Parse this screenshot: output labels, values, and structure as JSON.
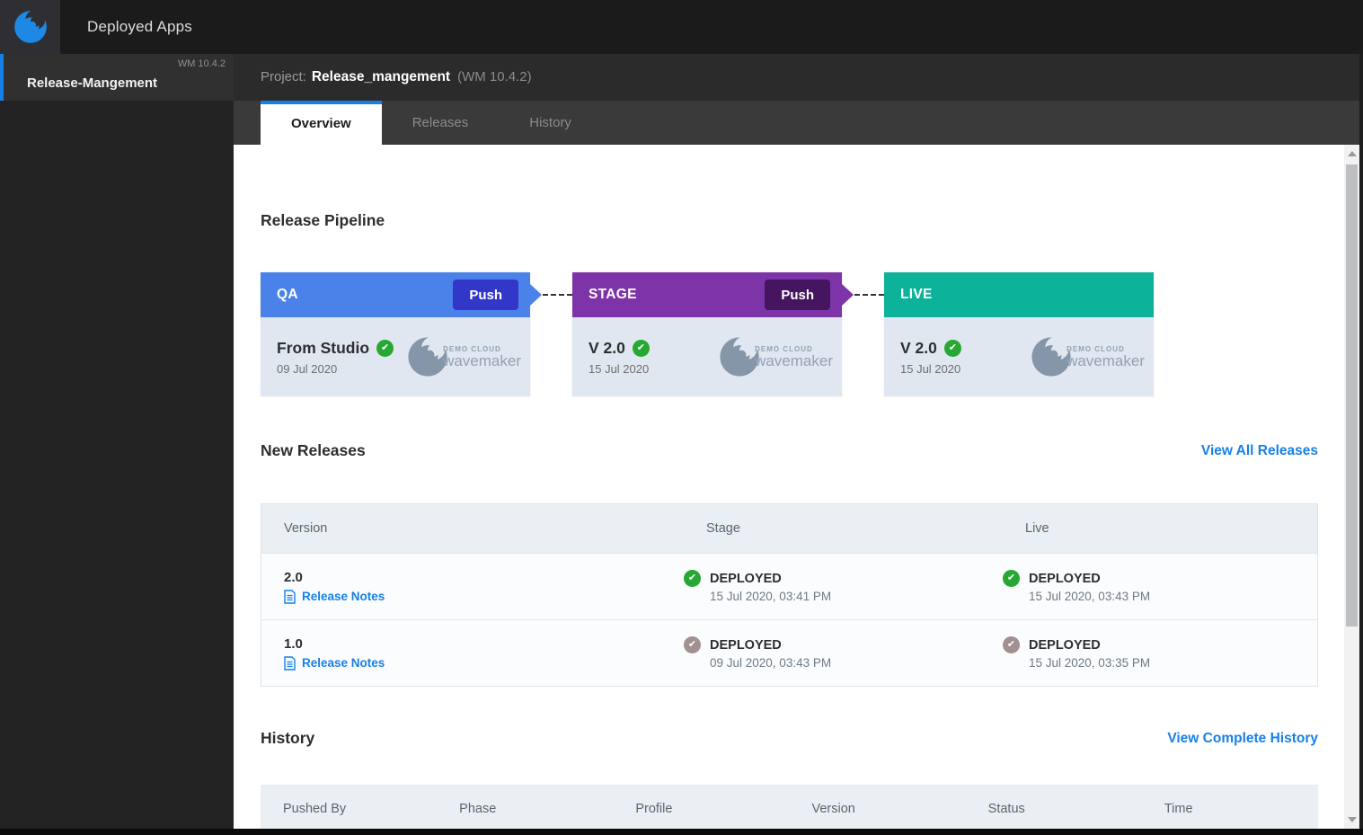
{
  "topbar": {
    "title": "Deployed Apps"
  },
  "sidebar": {
    "item": {
      "label": "Release-Mangement",
      "version": "WM 10.4.2"
    }
  },
  "project_header": {
    "prefix": "Project:",
    "name": "Release_mangement",
    "version": "(WM 10.4.2)"
  },
  "tabs": [
    {
      "label": "Overview",
      "active": true
    },
    {
      "label": "Releases",
      "active": false
    },
    {
      "label": "History",
      "active": false
    }
  ],
  "pipeline": {
    "heading": "Release Pipeline",
    "logo_text_top": "DEMO CLOUD",
    "logo_text_bottom": "wavemaker",
    "stages": [
      {
        "name": "QA",
        "push_label": "Push",
        "header_color": "#4a82ea",
        "push_color": "#3236c9",
        "version": "From Studio",
        "date": "09 Jul 2020",
        "check_color": "#26a832"
      },
      {
        "name": "STAGE",
        "push_label": "Push",
        "header_color": "#7d34a8",
        "push_color": "#45155f",
        "version": "V 2.0",
        "date": "15 Jul 2020",
        "check_color": "#26a832"
      },
      {
        "name": "LIVE",
        "header_color": "#0cb299",
        "version": "V 2.0",
        "date": "15 Jul 2020",
        "check_color": "#26a832"
      }
    ]
  },
  "new_releases": {
    "heading": "New Releases",
    "link": "View All Releases",
    "columns": [
      "Version",
      "Stage",
      "Live"
    ],
    "rows": [
      {
        "version": "2.0",
        "notes_label": "Release Notes",
        "stage": {
          "status": "DEPLOYED",
          "time": "15 Jul 2020, 03:41 PM",
          "check_color": "#26a832"
        },
        "live": {
          "status": "DEPLOYED",
          "time": "15 Jul 2020, 03:43 PM",
          "check_color": "#26a832"
        }
      },
      {
        "version": "1.0",
        "notes_label": "Release Notes",
        "stage": {
          "status": "DEPLOYED",
          "time": "09 Jul 2020, 03:43 PM",
          "check_color": "#a39090"
        },
        "live": {
          "status": "DEPLOYED",
          "time": "15 Jul 2020, 03:35 PM",
          "check_color": "#a39090"
        }
      }
    ]
  },
  "history": {
    "heading": "History",
    "link": "View Complete History",
    "columns": [
      "Pushed By",
      "Phase",
      "Profile",
      "Version",
      "Status",
      "Time"
    ]
  },
  "colors": {
    "accent_blue": "#1780e8",
    "qa_header": "#4a82ea",
    "qa_push": "#3236c9",
    "stage_header": "#7d34a8",
    "stage_push": "#45155f",
    "live_header": "#0cb299",
    "green_check": "#26a832",
    "muted_check": "#a39090",
    "brand_blue": "#1e88e5",
    "brand_gray": "#8496a8"
  }
}
